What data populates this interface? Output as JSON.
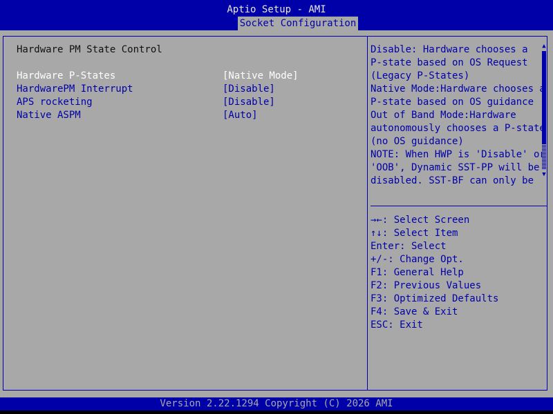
{
  "header": {
    "title": "Aptio Setup - AMI",
    "active_tab": "Socket Configuration"
  },
  "main": {
    "section_title": "Hardware PM State Control",
    "options": [
      {
        "label": "Hardware P-States",
        "value": "[Native Mode]",
        "selected": true
      },
      {
        "label": "HardwarePM Interrupt",
        "value": "[Disable]",
        "selected": false
      },
      {
        "label": "APS rocketing",
        "value": "[Disable]",
        "selected": false
      },
      {
        "label": "Native ASPM",
        "value": "[Auto]",
        "selected": false
      }
    ]
  },
  "help": {
    "lines": [
      "Disable: Hardware chooses a",
      "P-state based on OS Request",
      "(Legacy P-States)",
      "Native Mode:Hardware chooses a",
      "P-state based on OS guidance",
      "Out of Band Mode:Hardware",
      "autonomously chooses a P-state",
      "(no OS guidance)",
      "NOTE: When HWP is 'Disable' or",
      "'OOB', Dynamic SST-PP will be",
      "disabled. SST-BF can only be"
    ],
    "scroll_up_icon": "triangle-up-icon",
    "scroll_down_icon": "triangle-down-icon",
    "scroll_up_glyph": "▲",
    "scroll_down_glyph": "▼"
  },
  "keys": {
    "lines": [
      "→←: Select Screen",
      "↑↓: Select Item",
      "Enter: Select",
      "+/-: Change Opt.",
      "F1: General Help",
      "F2: Previous Values",
      "F3: Optimized Defaults",
      "F4: Save & Exit",
      "ESC: Exit"
    ]
  },
  "footer": {
    "text": "Version 2.22.1294 Copyright (C) 2026 AMI"
  },
  "colors": {
    "header_bg": "#0000a8",
    "body_bg": "#a8a8a8",
    "accent_text": "#0000a8",
    "selected_text": "#ffffff"
  }
}
